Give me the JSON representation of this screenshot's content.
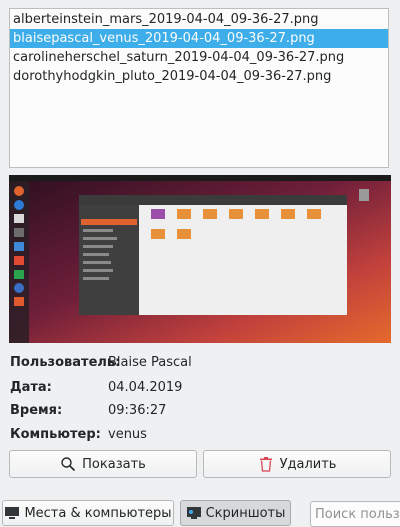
{
  "files": [
    "alberteinstein_mars_2019-04-04_09-36-27.png",
    "blaisepascal_venus_2019-04-04_09-36-27.png",
    "carolineherschel_saturn_2019-04-04_09-36-27.png",
    "dorothyhodgkin_pluto_2019-04-04_09-36-27.png"
  ],
  "selected_index": 1,
  "info": {
    "user_label": "Пользователь:",
    "user_value": "Blaise Pascal",
    "date_label": "Дата:",
    "date_value": "04.04.2019",
    "time_label": "Время:",
    "time_value": "09:36:27",
    "computer_label": "Компьютер:",
    "computer_value": "venus"
  },
  "buttons": {
    "show": "Показать",
    "delete": "Удалить"
  },
  "tabs": {
    "places": "Места & компьютеры",
    "screenshots": "Скриншоты"
  },
  "search": {
    "placeholder": "Поиск польз"
  },
  "colors": {
    "selection": "#3daee9",
    "delete_icon": "#da4453"
  }
}
